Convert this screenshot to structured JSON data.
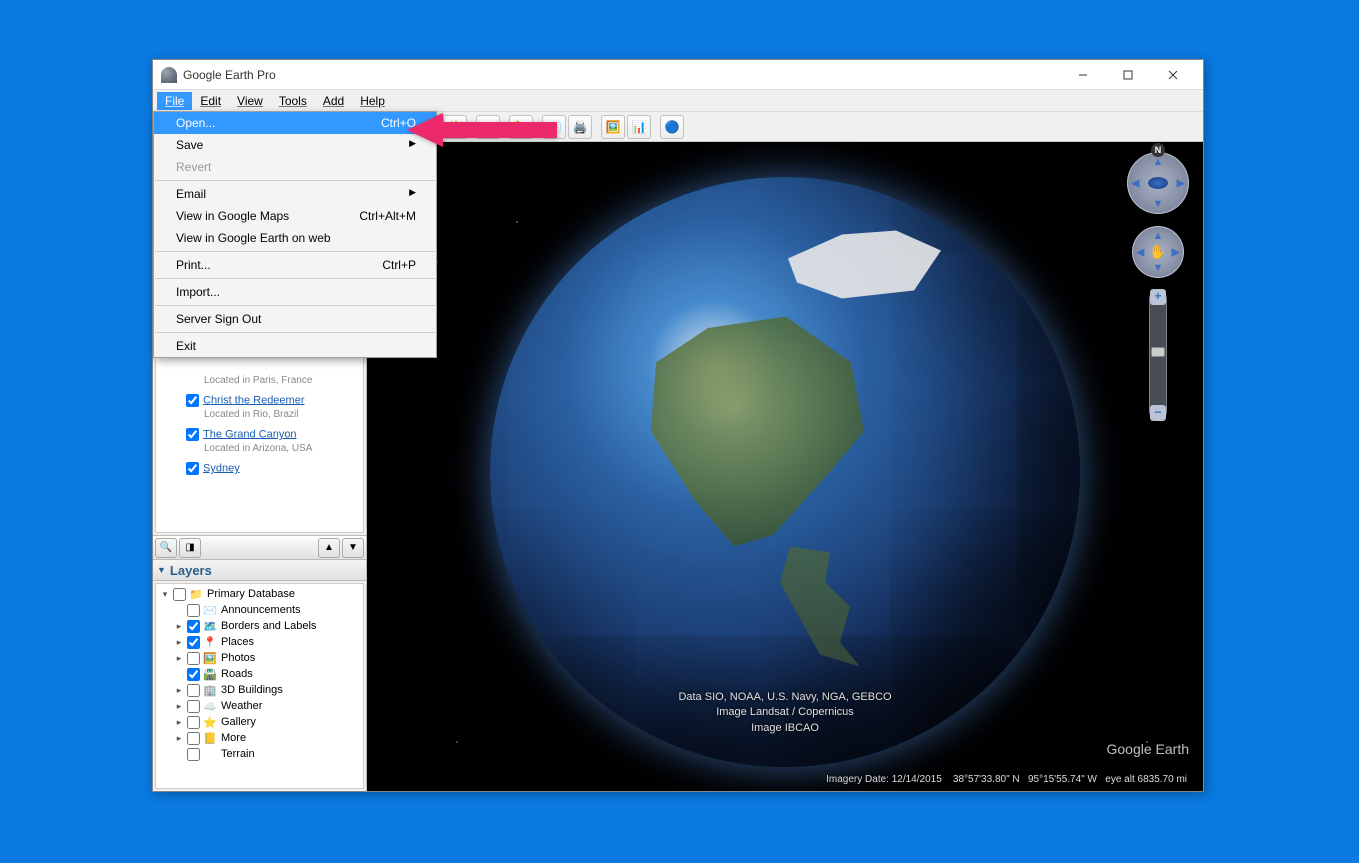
{
  "window": {
    "title": "Google Earth Pro"
  },
  "menubar": {
    "file": "File",
    "edit": "Edit",
    "view": "View",
    "tools": "Tools",
    "add": "Add",
    "help": "Help"
  },
  "dropdown": {
    "open": {
      "label": "Open...",
      "shortcut": "Ctrl+O"
    },
    "save": {
      "label": "Save"
    },
    "revert": {
      "label": "Revert"
    },
    "email": {
      "label": "Email"
    },
    "view_maps": {
      "label": "View in Google Maps",
      "shortcut": "Ctrl+Alt+M"
    },
    "view_web": {
      "label": "View in Google Earth on web"
    },
    "print": {
      "label": "Print...",
      "shortcut": "Ctrl+P"
    },
    "import": {
      "label": "Import..."
    },
    "signout": {
      "label": "Server Sign Out"
    },
    "exit": {
      "label": "Exit"
    }
  },
  "places": {
    "paris_desc": "Located in Paris, France",
    "christ": "Christ the Redeemer",
    "christ_desc": "Located in Rio, Brazil",
    "canyon": "The Grand Canyon",
    "canyon_desc": "Located in Arizona, USA",
    "sydney": "Sydney"
  },
  "layers": {
    "header": "Layers",
    "primary": "Primary Database",
    "announcements": "Announcements",
    "borders": "Borders and Labels",
    "places": "Places",
    "photos": "Photos",
    "roads": "Roads",
    "buildings": "3D Buildings",
    "weather": "Weather",
    "gallery": "Gallery",
    "more": "More",
    "terrain": "Terrain"
  },
  "attribution": {
    "line1": "Data SIO, NOAA, U.S. Navy, NGA, GEBCO",
    "line2": "Image Landsat / Copernicus",
    "line3": "Image IBCAO"
  },
  "watermark": "Google Earth",
  "statusbar": {
    "imagery": "Imagery Date: 12/14/2015",
    "lat": "38°57'33.80\" N",
    "lon": "95°15'55.74\" W",
    "alt": "eye alt 6835.70 mi"
  },
  "nav": {
    "n": "N"
  }
}
